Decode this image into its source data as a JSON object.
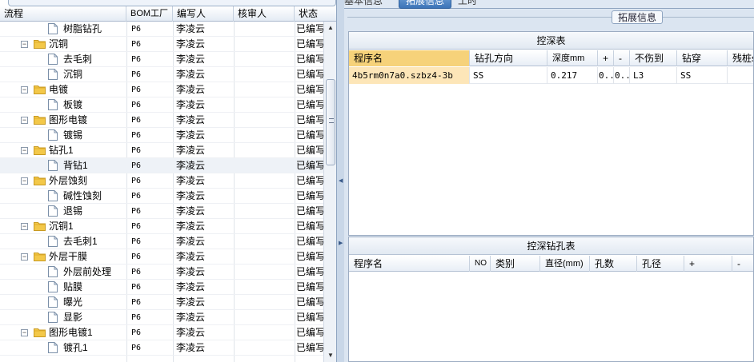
{
  "left_grid": {
    "columns": [
      "流程",
      "BOM工厂",
      "编写人",
      "核审人",
      "状态"
    ],
    "rows": [
      {
        "level": 2,
        "type": "doc",
        "name": "树脂钻孔",
        "bom": "P6",
        "writer": "李凌云",
        "reviewer": "",
        "status": "已编写"
      },
      {
        "level": 1,
        "type": "folder",
        "name": "沉铜",
        "bom": "P6",
        "writer": "李凌云",
        "reviewer": "",
        "status": "已编写"
      },
      {
        "level": 2,
        "type": "doc",
        "name": "去毛刺",
        "bom": "P6",
        "writer": "李凌云",
        "reviewer": "",
        "status": "已编写"
      },
      {
        "level": 2,
        "type": "doc",
        "name": "沉铜",
        "bom": "P6",
        "writer": "李凌云",
        "reviewer": "",
        "status": "已编写"
      },
      {
        "level": 1,
        "type": "folder",
        "name": "电镀",
        "bom": "P6",
        "writer": "李凌云",
        "reviewer": "",
        "status": "已编写"
      },
      {
        "level": 2,
        "type": "doc",
        "name": "板镀",
        "bom": "P6",
        "writer": "李凌云",
        "reviewer": "",
        "status": "已编写"
      },
      {
        "level": 1,
        "type": "folder",
        "name": "图形电镀",
        "bom": "P6",
        "writer": "李凌云",
        "reviewer": "",
        "status": "已编写"
      },
      {
        "level": 2,
        "type": "doc",
        "name": "镀锡",
        "bom": "P6",
        "writer": "李凌云",
        "reviewer": "",
        "status": "已编写"
      },
      {
        "level": 1,
        "type": "folder",
        "name": "钻孔1",
        "bom": "P6",
        "writer": "李凌云",
        "reviewer": "",
        "status": "已编写"
      },
      {
        "level": 2,
        "type": "doc",
        "name": "背钻1",
        "bom": "P6",
        "writer": "李凌云",
        "reviewer": "",
        "status": "已编写",
        "selected": true
      },
      {
        "level": 1,
        "type": "folder",
        "name": "外层蚀刻",
        "bom": "P6",
        "writer": "李凌云",
        "reviewer": "",
        "status": "已编写"
      },
      {
        "level": 2,
        "type": "doc",
        "name": "碱性蚀刻",
        "bom": "P6",
        "writer": "李凌云",
        "reviewer": "",
        "status": "已编写"
      },
      {
        "level": 2,
        "type": "doc",
        "name": "退锡",
        "bom": "P6",
        "writer": "李凌云",
        "reviewer": "",
        "status": "已编写"
      },
      {
        "level": 1,
        "type": "folder",
        "name": "沉铜1",
        "bom": "P6",
        "writer": "李凌云",
        "reviewer": "",
        "status": "已编写"
      },
      {
        "level": 2,
        "type": "doc",
        "name": "去毛刺1",
        "bom": "P6",
        "writer": "李凌云",
        "reviewer": "",
        "status": "已编写"
      },
      {
        "level": 1,
        "type": "folder",
        "name": "外层干膜",
        "bom": "P6",
        "writer": "李凌云",
        "reviewer": "",
        "status": "已编写"
      },
      {
        "level": 2,
        "type": "doc",
        "name": "外层前处理",
        "bom": "P6",
        "writer": "李凌云",
        "reviewer": "",
        "status": "已编写"
      },
      {
        "level": 2,
        "type": "doc",
        "name": "贴膜",
        "bom": "P6",
        "writer": "李凌云",
        "reviewer": "",
        "status": "已编写"
      },
      {
        "level": 2,
        "type": "doc",
        "name": "曝光",
        "bom": "P6",
        "writer": "李凌云",
        "reviewer": "",
        "status": "已编写"
      },
      {
        "level": 2,
        "type": "doc",
        "name": "显影",
        "bom": "P6",
        "writer": "李凌云",
        "reviewer": "",
        "status": "已编写"
      },
      {
        "level": 1,
        "type": "folder",
        "name": "图形电镀1",
        "bom": "P6",
        "writer": "李凌云",
        "reviewer": "",
        "status": "已编写"
      },
      {
        "level": 2,
        "type": "doc",
        "name": "镀孔1",
        "bom": "P6",
        "writer": "李凌云",
        "reviewer": "",
        "status": "已编写"
      }
    ]
  },
  "tabs": [
    "基本信息",
    "拓展信息",
    "工时"
  ],
  "active_tab": 1,
  "group_title": "拓展信息",
  "depth_table": {
    "title": "控深表",
    "columns": [
      "程序名",
      "钻孔方向",
      "深度mm",
      "+",
      "-",
      "不伤到",
      "钻穿",
      "残桩s"
    ],
    "rows": [
      [
        "4b5rm0n7a0.szbz4-3b",
        "SS",
        "0.217",
        "0..",
        "0..",
        "L3",
        "SS",
        ""
      ]
    ]
  },
  "hole_table": {
    "title": "控深钻孔表",
    "columns": [
      "程序名",
      "NO",
      "类别",
      "直径(mm)",
      "孔数",
      "孔径",
      "+",
      "-"
    ],
    "rows": []
  },
  "colors": {
    "highlight_header": "#f6d27a",
    "highlight_cell": "#fde6b8",
    "active_tab": "#3c74b8"
  }
}
